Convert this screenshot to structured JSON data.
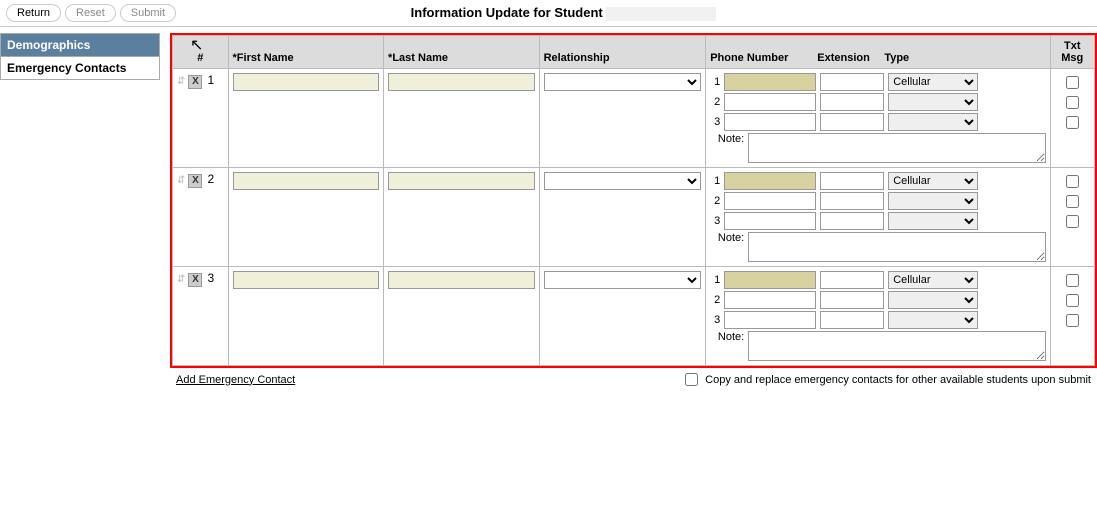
{
  "toolbar": {
    "return_label": "Return",
    "reset_label": "Reset",
    "submit_label": "Submit"
  },
  "page_title": "Information Update for Student",
  "sidebar": {
    "items": [
      {
        "label": "Demographics",
        "selected": true
      },
      {
        "label": "Emergency Contacts",
        "selected": false
      }
    ]
  },
  "table": {
    "headers": {
      "num": "#",
      "first_name": "*First Name",
      "last_name": "*Last Name",
      "relationship": "Relationship",
      "phone_number": "Phone Number",
      "extension": "Extension",
      "type": "Type",
      "txt_msg_line1": "Txt",
      "txt_msg_line2": "Msg"
    },
    "note_label": "Note:",
    "phone_type_options": [
      "",
      "Cellular"
    ],
    "rows": [
      {
        "index": "1",
        "first_name": "",
        "last_name": "",
        "relationship": "",
        "phones": [
          {
            "n": "1",
            "number": "",
            "ext": "",
            "type": "Cellular",
            "txtmsg": false
          },
          {
            "n": "2",
            "number": "",
            "ext": "",
            "type": "",
            "txtmsg": false
          },
          {
            "n": "3",
            "number": "",
            "ext": "",
            "type": "",
            "txtmsg": false
          }
        ],
        "note": ""
      },
      {
        "index": "2",
        "first_name": "",
        "last_name": "",
        "relationship": "",
        "phones": [
          {
            "n": "1",
            "number": "",
            "ext": "",
            "type": "Cellular",
            "txtmsg": false
          },
          {
            "n": "2",
            "number": "",
            "ext": "",
            "type": "",
            "txtmsg": false
          },
          {
            "n": "3",
            "number": "",
            "ext": "",
            "type": "",
            "txtmsg": false
          }
        ],
        "note": ""
      },
      {
        "index": "3",
        "first_name": "",
        "last_name": "",
        "relationship": "",
        "phones": [
          {
            "n": "1",
            "number": "",
            "ext": "",
            "type": "Cellular",
            "txtmsg": false
          },
          {
            "n": "2",
            "number": "",
            "ext": "",
            "type": "",
            "txtmsg": false
          },
          {
            "n": "3",
            "number": "",
            "ext": "",
            "type": "",
            "txtmsg": false
          }
        ],
        "note": ""
      }
    ]
  },
  "footer": {
    "add_link": "Add Emergency Contact",
    "copy_label": "Copy and replace emergency contacts for other available students upon submit"
  }
}
